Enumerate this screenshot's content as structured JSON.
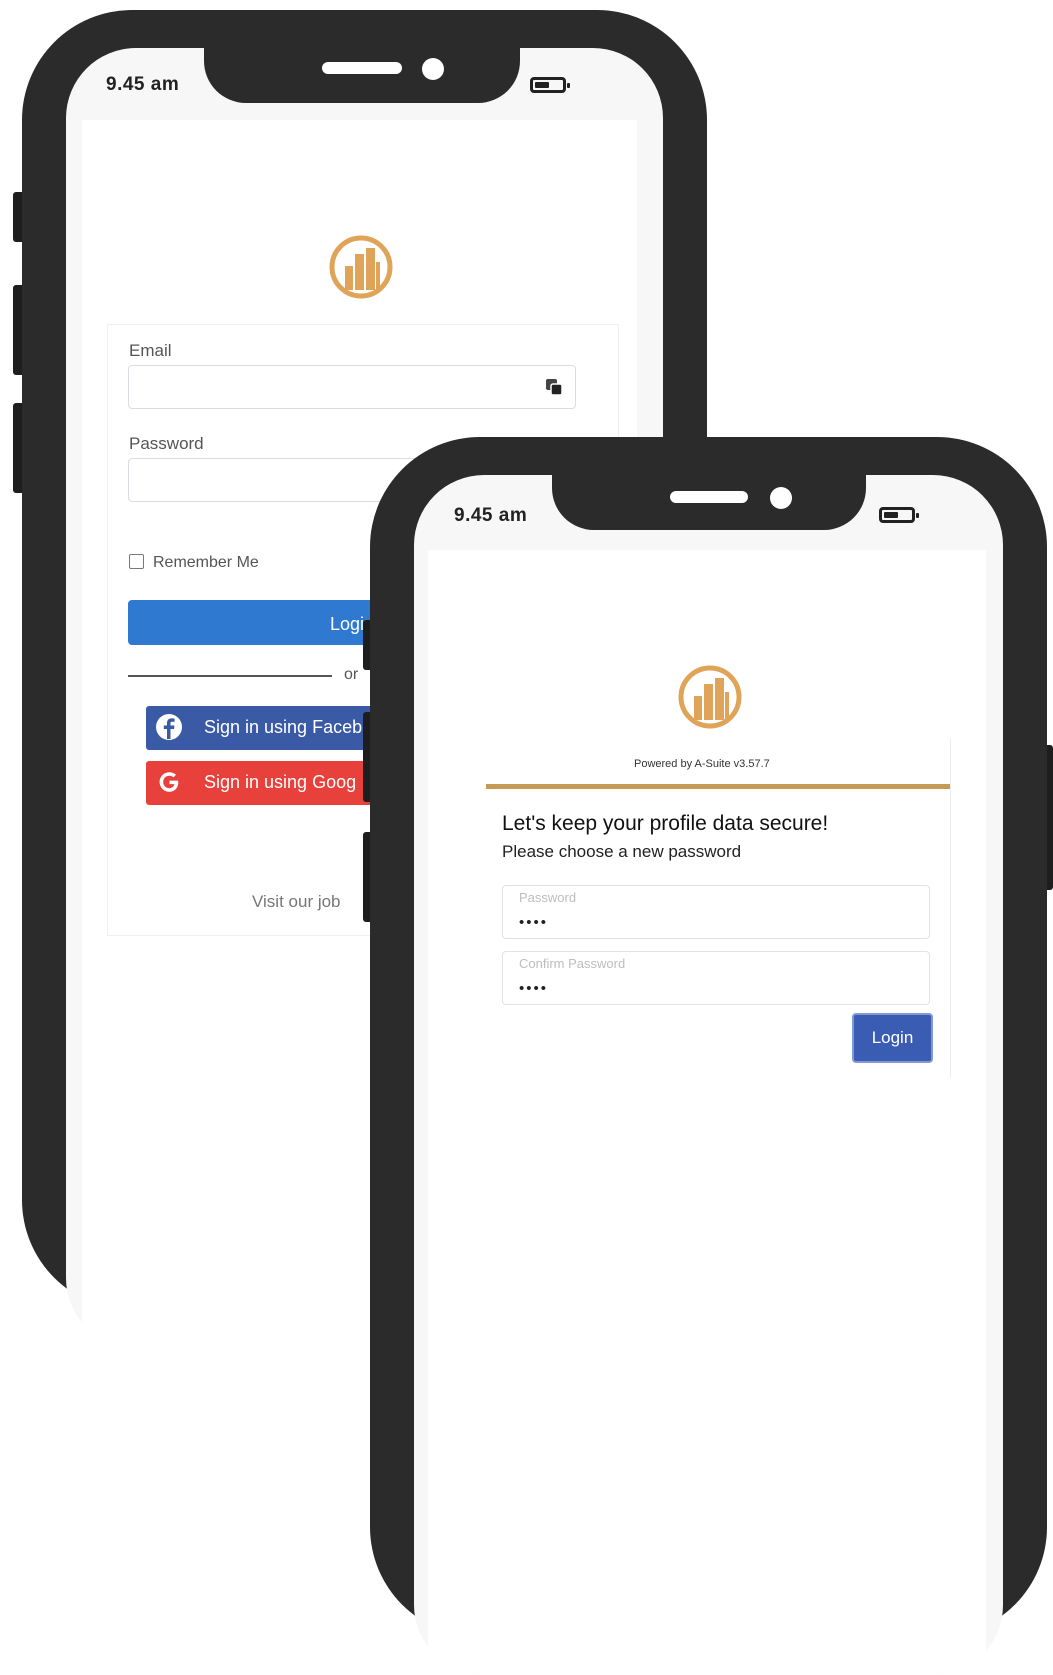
{
  "status_bar": {
    "time": "9.45 am"
  },
  "login_screen": {
    "email_label": "Email",
    "password_label": "Password",
    "remember_me": "Remember Me",
    "login_button": "Logi",
    "or_text": "or",
    "facebook_button": "Sign in using Faceb",
    "google_button": "Sign in using Goog",
    "footer_link": "Visit our job"
  },
  "reset_screen": {
    "powered_by": "Powered by A-Suite v3.57.7",
    "title": "Let's keep your profile data secure!",
    "subtitle": "Please choose a new password",
    "password_placeholder": "Password",
    "password_value": "••••",
    "confirm_placeholder": "Confirm Password",
    "confirm_value": "••••",
    "login_button": "Login"
  },
  "colors": {
    "brand_gold": "#e0a458",
    "accent_line": "#c49a55",
    "login_blue": "#2f7ad0",
    "facebook": "#3b5aa6",
    "google": "#e8403b",
    "submit_blue": "#3a5cb3"
  },
  "icons": {
    "logo": "building-circle-logo",
    "facebook": "facebook-icon",
    "google": "google-icon",
    "autofill": "autofill-icon",
    "battery": "battery-icon"
  }
}
